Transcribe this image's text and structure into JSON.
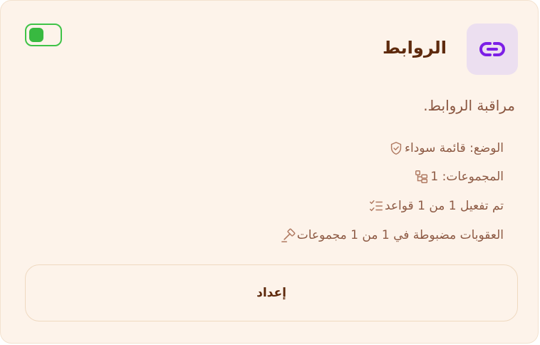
{
  "card": {
    "title": "الروابط",
    "description": "مراقبة الروابط.",
    "icon": "link-icon",
    "toggle": {
      "enabled": true,
      "color": "#38b940"
    },
    "info_rows": [
      {
        "icon": "shield-check-icon",
        "text": "الوضع: قائمة سوداء"
      },
      {
        "icon": "groups-icon",
        "text": "المجموعات: 1"
      },
      {
        "icon": "checklist-icon",
        "text": "تم تفعيل 1 من 1 قواعد"
      },
      {
        "icon": "gavel-icon",
        "text": "العقوبات مضبوطة في 1 من 1 مجموعات"
      }
    ],
    "setup_button_label": "إعداد"
  },
  "colors": {
    "background": "#fdf3ea",
    "accent_purple": "#7c1fe6",
    "icon_tile": "#ecdff0",
    "title": "#5e2a0d",
    "text": "#8d5a44",
    "toggle": "#38b940"
  }
}
